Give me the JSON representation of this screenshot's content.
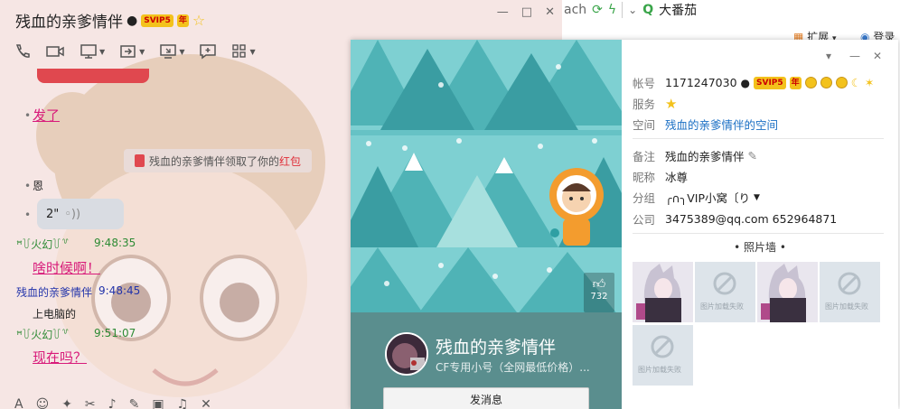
{
  "browser": {
    "addr_fragment": "ach",
    "search_text": "大番茄",
    "ext_label": "扩展",
    "login_label": "登录"
  },
  "chat": {
    "title": "残血的亲爹情伴",
    "vip_badge": "SVIP5",
    "year_badge": "年",
    "messages": {
      "sent1": "发了",
      "system_prefix": "残血的亲爹情伴领取了你的",
      "system_red": "红包",
      "reply1": "恩",
      "voice_len": "2\"",
      "nick1": "ꟸ꒦火幻꒦꒷",
      "time1": "9:48:35",
      "msg1": "啥时候啊！",
      "nick2": "残血的亲爹情伴",
      "time2": "9:48:45",
      "msg2": "上电脑的",
      "nick3": "ꟸ꒦火幻꒦꒷",
      "time3": "9:51:07",
      "msg3": "现在吗？"
    }
  },
  "card": {
    "likes": "732",
    "name": "残血的亲爹情伴",
    "signature": "CF专用小号（全网最低价格）...",
    "send_label": "发消息",
    "fields": {
      "account_k": "帐号",
      "account_v": "1171247030",
      "service_k": "服务",
      "space_k": "空间",
      "space_v": "残血的亲爹情伴的空间",
      "remark_k": "备注",
      "remark_v": "残血的亲爹情伴",
      "nick_k": "昵称",
      "nick_v": "冰尊",
      "group_k": "分组",
      "group_v": "╭∩╮VIP小窝〔り",
      "company_k": "公司",
      "company_v": "3475389@qq.com 652964871"
    },
    "photo_wall": "照片墙",
    "broken_caption": "图片加载失败"
  },
  "colors": {
    "accent_pink": "#d81b7a",
    "nick_green": "#2e8b35",
    "link_blue": "#1a6fc4",
    "teal": "#5aa6a6"
  }
}
